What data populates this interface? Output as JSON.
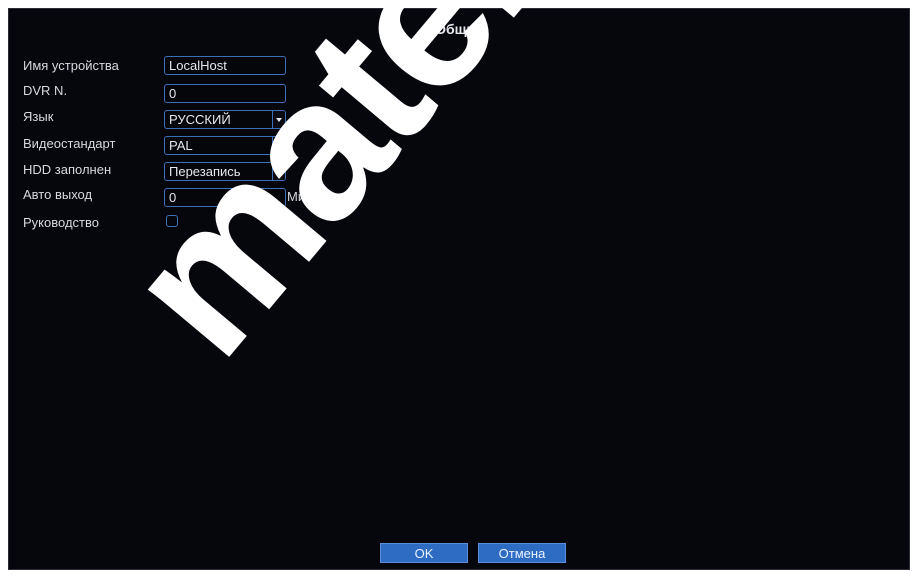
{
  "window": {
    "title": "Общие"
  },
  "form": {
    "device_name": {
      "label": "Имя устройства",
      "value": "LocalHost"
    },
    "dvr_no": {
      "label": "DVR N.",
      "value": "0"
    },
    "language": {
      "label": "Язык",
      "value": "РУССКИЙ"
    },
    "video_standard": {
      "label": "Видеостандарт",
      "value": "PAL"
    },
    "hdd_full": {
      "label": "HDD заполнен",
      "value": "Перезапись"
    },
    "auto_logout": {
      "label": "Авто выход",
      "value": "0",
      "unit": "Мин."
    },
    "wizard": {
      "label": "Руководство",
      "checked": false
    }
  },
  "buttons": {
    "ok": "OK",
    "cancel": "Отмена"
  },
  "watermark": {
    "text": "matek"
  },
  "colors": {
    "accent": "#3d6fb8",
    "button": "#2e6cc4",
    "background": "#06070c"
  }
}
